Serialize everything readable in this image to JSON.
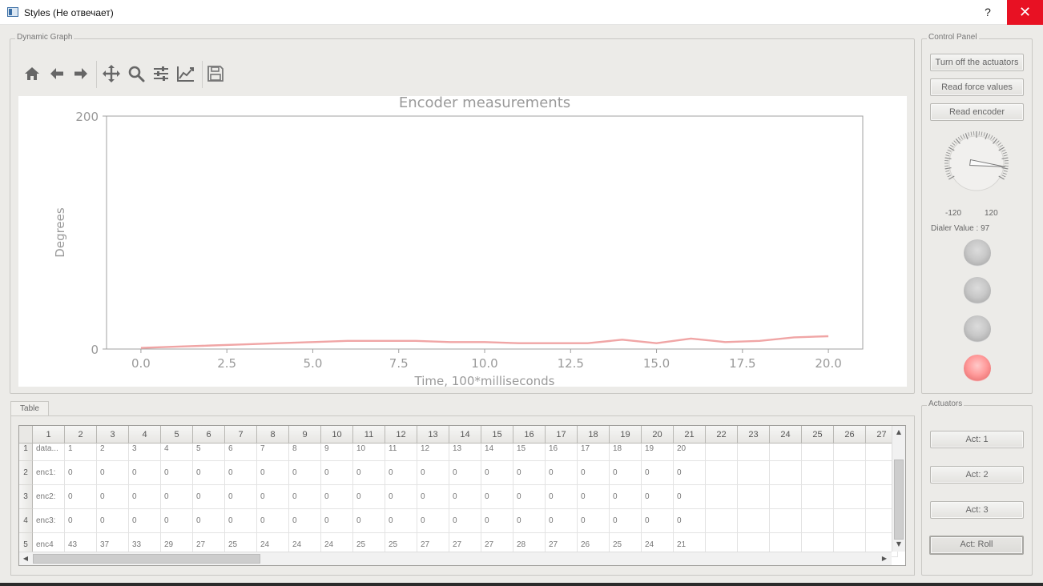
{
  "window": {
    "title": "Styles (Не отвечает)",
    "help_label": "?",
    "close_label": "✕"
  },
  "graph_panel": {
    "title": "Dynamic Graph",
    "toolbar": [
      "home-icon",
      "back-arrow-icon",
      "forward-arrow-icon",
      "pan-icon",
      "zoom-icon",
      "configure-subplots-icon",
      "edit-axis-icon",
      "save-icon"
    ]
  },
  "chart_data": {
    "type": "line",
    "title": "Encoder measurements",
    "xlabel": "Time, 100*milliseconds",
    "ylabel": "Degrees",
    "xlim": [
      -1,
      21
    ],
    "ylim": [
      0,
      200
    ],
    "xticks": [
      "0.0",
      "2.5",
      "5.0",
      "7.5",
      "10.0",
      "12.5",
      "15.0",
      "17.5",
      "20.0"
    ],
    "yticks": [
      "0",
      "200"
    ],
    "color": "#f0a5a5",
    "series": [
      {
        "x": [
          0,
          1,
          2,
          3,
          4,
          5,
          6,
          7,
          8,
          9,
          10,
          11,
          12,
          13,
          14,
          15,
          16,
          17,
          18,
          19,
          20
        ],
        "values": [
          1,
          2,
          3,
          4,
          5,
          6,
          7,
          7,
          7,
          6,
          6,
          5,
          5,
          5,
          8,
          5,
          9,
          6,
          7,
          10,
          11
        ]
      }
    ]
  },
  "control_panel": {
    "title": "Control Panel",
    "buttons": [
      "Turn off the actuators",
      "Read force values",
      "Read encoder"
    ],
    "dial_min": "-120",
    "dial_max": "120",
    "dial_value_text": "Dialer Value : 97",
    "dial_value": 97,
    "lights": [
      false,
      false,
      false,
      true
    ]
  },
  "actuators": {
    "title": "Actuators",
    "buttons": [
      "Act: 1",
      "Act: 2",
      "Act: 3",
      "Act: Roll"
    ]
  },
  "table": {
    "tab_label": "Table",
    "columns": [
      "1",
      "2",
      "3",
      "4",
      "5",
      "6",
      "7",
      "8",
      "9",
      "10",
      "11",
      "12",
      "13",
      "14",
      "15",
      "16",
      "17",
      "18",
      "19",
      "20",
      "21",
      "22",
      "23",
      "24",
      "25",
      "26",
      "27"
    ],
    "row_numbers": [
      "1",
      "2",
      "3",
      "4",
      "5"
    ],
    "rows": [
      [
        "data...",
        "1",
        "2",
        "3",
        "4",
        "5",
        "6",
        "7",
        "8",
        "9",
        "10",
        "11",
        "12",
        "13",
        "14",
        "15",
        "16",
        "17",
        "18",
        "19",
        "20"
      ],
      [
        "enc1:",
        "0",
        "0",
        "0",
        "0",
        "0",
        "0",
        "0",
        "0",
        "0",
        "0",
        "0",
        "0",
        "0",
        "0",
        "0",
        "0",
        "0",
        "0",
        "0",
        "0"
      ],
      [
        "enc2:",
        "0",
        "0",
        "0",
        "0",
        "0",
        "0",
        "0",
        "0",
        "0",
        "0",
        "0",
        "0",
        "0",
        "0",
        "0",
        "0",
        "0",
        "0",
        "0",
        "0"
      ],
      [
        "enc3:",
        "0",
        "0",
        "0",
        "0",
        "0",
        "0",
        "0",
        "0",
        "0",
        "0",
        "0",
        "0",
        "0",
        "0",
        "0",
        "0",
        "0",
        "0",
        "0",
        "0"
      ],
      [
        "enc4",
        "43",
        "37",
        "33",
        "29",
        "27",
        "25",
        "24",
        "24",
        "24",
        "25",
        "25",
        "27",
        "27",
        "27",
        "28",
        "27",
        "26",
        "25",
        "24",
        "21"
      ]
    ]
  }
}
